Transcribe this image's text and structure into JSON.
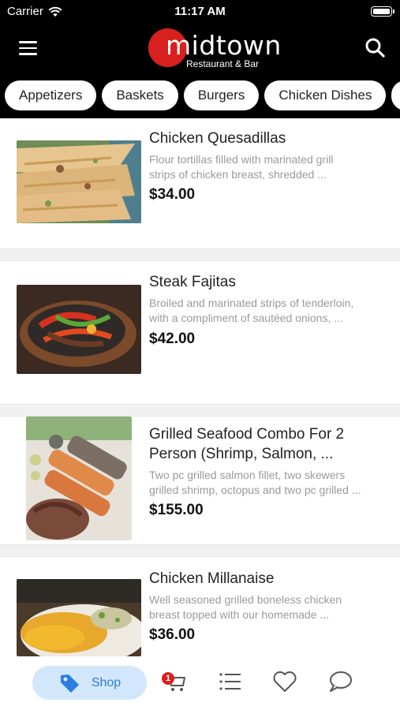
{
  "status_bar": {
    "carrier": "Carrier",
    "time": "11:17 AM"
  },
  "header": {
    "logo_text": "midtown",
    "logo_subtitle": "Restaurant & Bar",
    "logo_accent": "#d8201f"
  },
  "categories": [
    "Appetizers",
    "Baskets",
    "Burgers",
    "Chicken Dishes"
  ],
  "menu_items": [
    {
      "name": "Chicken Quesadillas",
      "desc_line1": "Flour tortillas filled with marinated grill",
      "desc_line2": "strips of chicken breast, shredded ...",
      "price": "$34.00"
    },
    {
      "name": "Steak Fajitas",
      "desc_line1": "Broiled and marinated strips of tenderloin,",
      "desc_line2": "with a compliment of sautéed onions, ...",
      "price": "$42.00"
    },
    {
      "name_line1": "Grilled Seafood Combo For 2",
      "name_line2": "Person (Shrimp, Salmon, ...",
      "desc_line1": "Two pc grilled salmon fillet, two skewers",
      "desc_line2": "grilled shrimp, octopus and two pc grilled ...",
      "price": "$155.00"
    },
    {
      "name": "Chicken Millanaise",
      "desc_line1": "Well seasoned grilled boneless chicken",
      "desc_line2": "breast topped with our homemade ...",
      "price": "$36.00"
    }
  ],
  "tab_bar": {
    "shop_label": "Shop",
    "cart_count": "1",
    "accent": "#2b7de0"
  }
}
